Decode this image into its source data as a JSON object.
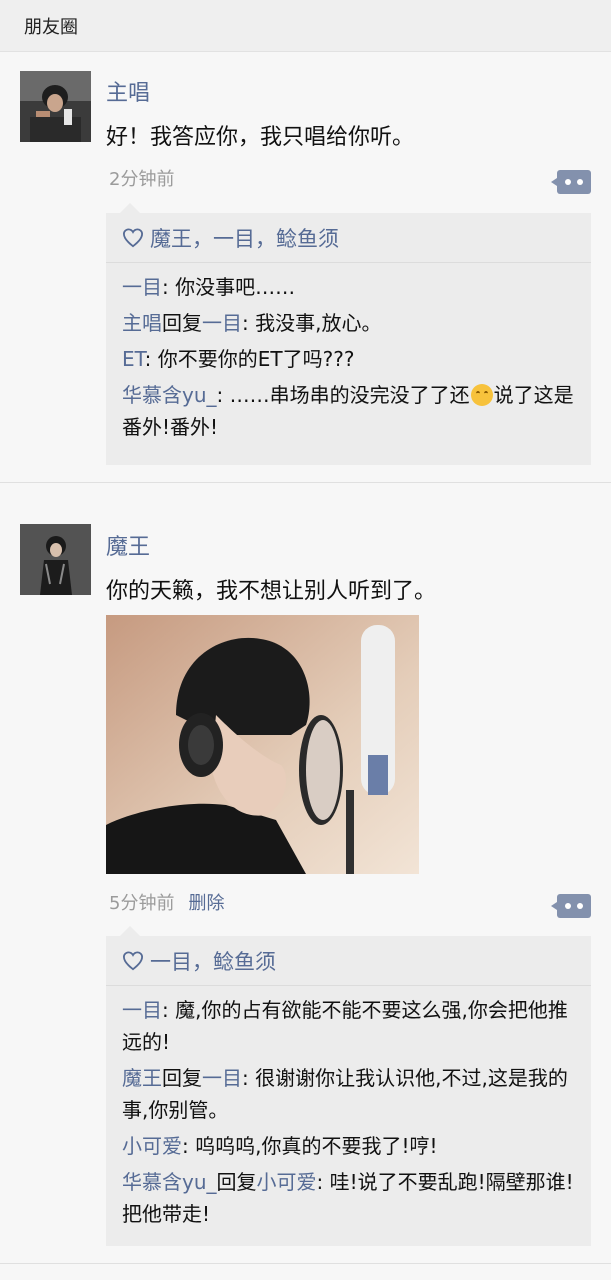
{
  "header": {
    "title": "朋友圈"
  },
  "posts": [
    {
      "author": "主唱",
      "text": "好！我答应你，我只唱给你听。",
      "time": "2分钟前",
      "likes": "魔王，一目，鲶鱼须",
      "comments": [
        {
          "name": "一目",
          "sep": ": ",
          "text": "你没事吧……"
        },
        {
          "name": "主唱",
          "reply_word": "回复",
          "reply_to": "一目",
          "sep": ": ",
          "text": "我没事,放心。"
        },
        {
          "name": "ET",
          "sep": ": ",
          "text": "你不要你的ET了吗???"
        },
        {
          "name": "华慕含yu_",
          "sep": ": ",
          "text": "……串场串的没完没了了还",
          "emoji": "upside-down-face-emoji",
          "text_after": "说了这是番外!番外!"
        }
      ]
    },
    {
      "author": "魔王",
      "text": "你的天籁，我不想让别人听到了。",
      "time": "5分钟前",
      "delete_label": "删除",
      "likes": "一目，鲶鱼须",
      "comments": [
        {
          "name": "一目",
          "sep": ": ",
          "text": "魔,你的占有欲能不能不要这么强,你会把他推远的!"
        },
        {
          "name": "魔王",
          "reply_word": "回复",
          "reply_to": "一目",
          "sep": ": ",
          "text": "很谢谢你让我认识他,不过,这是我的事,你别管。"
        },
        {
          "name": "小可爱",
          "sep": ": ",
          "text": "呜呜呜,你真的不要我了!哼!"
        },
        {
          "name": "华慕含yu_",
          "reply_word": "回复",
          "reply_to": "小可爱",
          "sep": ": ",
          "text": "哇!说了不要乱跑!隔壁那谁!把他带走!"
        }
      ]
    }
  ],
  "colors": {
    "name_link": "#566b95",
    "timestamp": "#9b9b9b",
    "panel_bg": "#ececec",
    "page_bg": "#f7f7f7"
  }
}
